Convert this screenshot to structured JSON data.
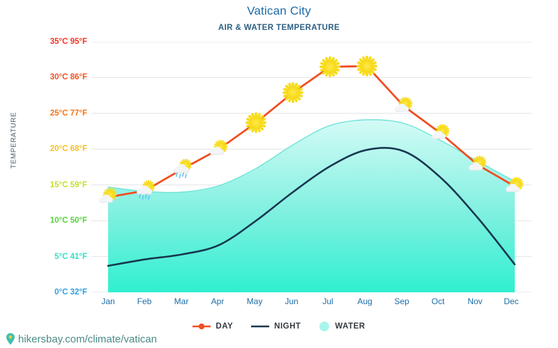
{
  "header": {
    "title": "Vatican City",
    "subtitle": "AIR & WATER TEMPERATURE"
  },
  "footer": {
    "pin_icon": "location-pin-icon",
    "url": "hikersbay.com/climate/vatican"
  },
  "legend": {
    "position": "bottom-center",
    "items": [
      {
        "label": "DAY",
        "color": "#f04e23",
        "marker": "line-with-dot"
      },
      {
        "label": "NIGHT",
        "color": "#17374f",
        "marker": "line"
      },
      {
        "label": "WATER",
        "color": "#a8f5ec",
        "marker": "circle"
      }
    ]
  },
  "colors": {
    "day_line": "#f04e23",
    "night_line": "#17374f",
    "water_line": "#6fe3d8",
    "water_fill_top": "#d4fbf6",
    "water_fill_bottom": "#2ff0cf",
    "gridline": "#e2e2e2",
    "title": "#1c6ca8",
    "xtick": "#1c6ca8",
    "footer": "#4a8b86"
  },
  "chart_data": {
    "type": "line",
    "title": "Vatican City",
    "subtitle": "AIR & WATER TEMPERATURE",
    "xlabel": "",
    "ylabel": "TEMPERATURE",
    "grid": true,
    "ylim": [
      0,
      35
    ],
    "categories": [
      "Jan",
      "Feb",
      "Feb",
      "Mar",
      "Apr",
      "May",
      "Jun",
      "Jul",
      "Aug",
      "Sep",
      "Oct",
      "Nov",
      "Dec"
    ],
    "x": [
      "Jan",
      "Feb",
      "Mar",
      "Apr",
      "May",
      "Jun",
      "Jul",
      "Aug",
      "Sep",
      "Oct",
      "Nov",
      "Dec"
    ],
    "yticks": [
      {
        "value": 35,
        "label": "35°C 95°F",
        "color": "#f4321f"
      },
      {
        "value": 30,
        "label": "30°C 86°F",
        "color": "#f4511e"
      },
      {
        "value": 25,
        "label": "25°C 77°F",
        "color": "#f97316"
      },
      {
        "value": 20,
        "label": "20°C 68°F",
        "color": "#f4c020"
      },
      {
        "value": 15,
        "label": "15°C 59°F",
        "color": "#c7e02a"
      },
      {
        "value": 10,
        "label": "10°C 50°F",
        "color": "#56d43a"
      },
      {
        "value": 5,
        "label": "5°C 41°F",
        "color": "#2ee0c8"
      },
      {
        "value": 0,
        "label": "0°C 32°F",
        "color": "#2e9fe0"
      }
    ],
    "series": [
      {
        "name": "DAY",
        "color": "#f04e23",
        "values": [
          13.3,
          14.2,
          17.2,
          20.0,
          23.7,
          27.9,
          31.5,
          31.6,
          26.0,
          22.2,
          17.8,
          14.8
        ],
        "icons": [
          "sun-behind-cloud-icon",
          "rain-cloud-sun-icon",
          "rain-cloud-sun-icon",
          "sun-behind-cloud-icon",
          "sun-icon",
          "sun-icon",
          "sun-icon",
          "sun-icon",
          "sun-behind-cloud-icon",
          "sun-behind-cloud-icon",
          "sun-behind-cloud-icon",
          "sun-behind-cloud-icon"
        ]
      },
      {
        "name": "NIGHT",
        "color": "#17374f",
        "values": [
          3.7,
          4.6,
          5.3,
          6.6,
          10.0,
          14.0,
          17.6,
          19.9,
          19.7,
          16.0,
          10.4,
          3.9
        ]
      },
      {
        "name": "WATER",
        "color": "#6fe3d8",
        "values": [
          14.7,
          14.1,
          14.0,
          14.9,
          17.3,
          20.6,
          23.3,
          24.1,
          23.6,
          21.2,
          18.3,
          15.5
        ]
      }
    ]
  }
}
